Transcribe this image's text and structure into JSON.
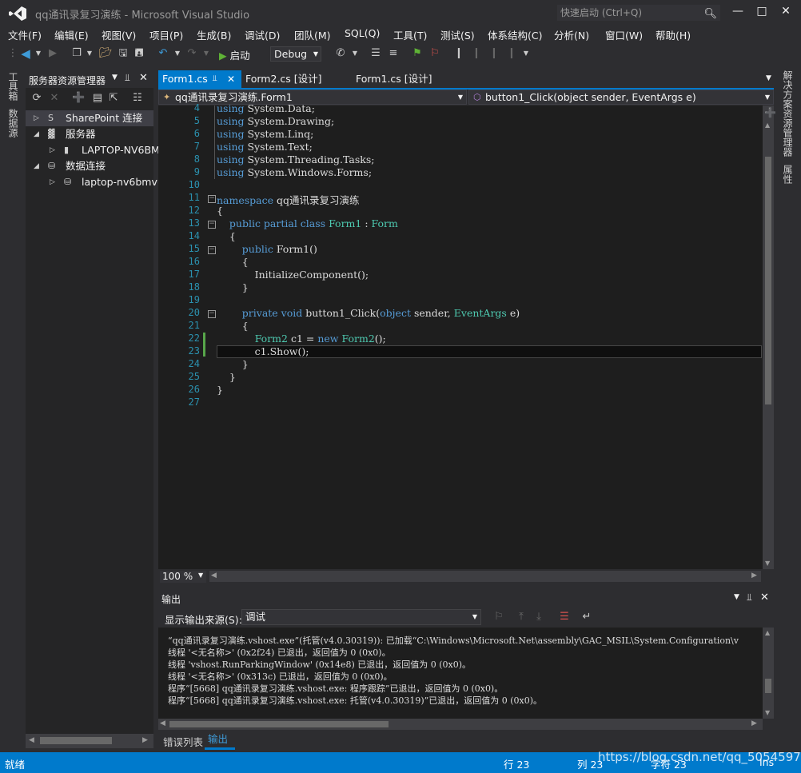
{
  "window": {
    "title": "qq通讯录复习演练 - Microsoft Visual Studio",
    "quick_launch_placeholder": "快速启动 (Ctrl+Q)"
  },
  "menu": [
    "文件(F)",
    "编辑(E)",
    "视图(V)",
    "项目(P)",
    "生成(B)",
    "调试(D)",
    "团队(M)",
    "SQL(Q)",
    "工具(T)",
    "测试(S)",
    "体系结构(C)",
    "分析(N)",
    "窗口(W)",
    "帮助(H)"
  ],
  "toolbar": {
    "start_label": "启动",
    "config": "Debug"
  },
  "left_tabs": [
    "工具箱",
    "数据源"
  ],
  "server_explorer": {
    "title": "服务器资源管理器",
    "tree": [
      {
        "label": "SharePoint 连接",
        "level": 0,
        "expanded": false,
        "selected": true
      },
      {
        "label": "服务器",
        "level": 0,
        "expanded": true
      },
      {
        "label": "LAPTOP-NV6BM",
        "level": 1,
        "expanded": false
      },
      {
        "label": "数据连接",
        "level": 0,
        "expanded": true
      },
      {
        "label": "laptop-nv6bmvu",
        "level": 1,
        "expanded": false
      }
    ]
  },
  "doc_tabs": [
    {
      "label": "Form1.cs",
      "active": true
    },
    {
      "label": "Form2.cs [设计]",
      "active": false
    },
    {
      "label": "Form1.cs [设计]",
      "active": false
    }
  ],
  "nav": {
    "class_sel": "qq通讯录复习演练.Form1",
    "member_sel": "button1_Click(object sender, EventArgs e)"
  },
  "code": {
    "line_numbers": [
      "4",
      "5",
      "6",
      "7",
      "8",
      "9",
      "10",
      "11",
      "12",
      "13",
      "14",
      "15",
      "16",
      "17",
      "18",
      "19",
      "20",
      "21",
      "22",
      "23",
      "24",
      "25",
      "26",
      "27"
    ],
    "lines": [
      [
        {
          "t": "using",
          "c": "kw"
        },
        {
          "t": " System.Data;",
          "c": ""
        }
      ],
      [
        {
          "t": "using",
          "c": "kw"
        },
        {
          "t": " System.Drawing;",
          "c": ""
        }
      ],
      [
        {
          "t": "using",
          "c": "kw"
        },
        {
          "t": " System.Linq;",
          "c": ""
        }
      ],
      [
        {
          "t": "using",
          "c": "kw"
        },
        {
          "t": " System.Text;",
          "c": ""
        }
      ],
      [
        {
          "t": "using",
          "c": "kw"
        },
        {
          "t": " System.Threading.Tasks;",
          "c": ""
        }
      ],
      [
        {
          "t": "using",
          "c": "kw"
        },
        {
          "t": " System.Windows.Forms;",
          "c": ""
        }
      ],
      [],
      [
        {
          "t": "namespace",
          "c": "kw"
        },
        {
          "t": " qq通讯录复习演练",
          "c": ""
        }
      ],
      [
        {
          "t": "{",
          "c": ""
        }
      ],
      [
        {
          "t": "    public partial class",
          "c": "kw"
        },
        {
          "t": " ",
          "c": ""
        },
        {
          "t": "Form1",
          "c": "ty"
        },
        {
          "t": " : ",
          "c": ""
        },
        {
          "t": "Form",
          "c": "ty"
        }
      ],
      [
        {
          "t": "    {",
          "c": ""
        }
      ],
      [
        {
          "t": "        public",
          "c": "kw"
        },
        {
          "t": " Form1()",
          "c": ""
        }
      ],
      [
        {
          "t": "        {",
          "c": ""
        }
      ],
      [
        {
          "t": "            InitializeComponent();",
          "c": ""
        }
      ],
      [
        {
          "t": "        }",
          "c": ""
        }
      ],
      [],
      [
        {
          "t": "        private void",
          "c": "kw"
        },
        {
          "t": " button1_Click(",
          "c": ""
        },
        {
          "t": "object",
          "c": "kw"
        },
        {
          "t": " sender, ",
          "c": ""
        },
        {
          "t": "EventArgs",
          "c": "ty"
        },
        {
          "t": " e)",
          "c": ""
        }
      ],
      [
        {
          "t": "        {",
          "c": ""
        }
      ],
      [
        {
          "t": "            ",
          "c": ""
        },
        {
          "t": "Form2",
          "c": "ty"
        },
        {
          "t": " c1 = ",
          "c": ""
        },
        {
          "t": "new",
          "c": "kw"
        },
        {
          "t": " ",
          "c": ""
        },
        {
          "t": "Form2",
          "c": "ty"
        },
        {
          "t": "();",
          "c": ""
        }
      ],
      [
        {
          "t": "            c1.Show();",
          "c": ""
        }
      ],
      [
        {
          "t": "        }",
          "c": ""
        }
      ],
      [
        {
          "t": "    }",
          "c": ""
        }
      ],
      [
        {
          "t": "}",
          "c": ""
        }
      ],
      []
    ]
  },
  "editor_zoom": "100 %",
  "output": {
    "title": "输出",
    "source_label": "显示输出来源(S):",
    "source_value": "调试",
    "lines": [
      "“qq通讯录复习演练.vshost.exe”(托管(v4.0.30319)): 已加载“C:\\Windows\\Microsoft.Net\\assembly\\GAC_MSIL\\System.Configuration\\v",
      "线程 '<无名称>' (0x2f24) 已退出，返回值为 0 (0x0)。",
      "线程 'vshost.RunParkingWindow' (0x14e8) 已退出，返回值为 0 (0x0)。",
      "线程 '<无名称>' (0x313c) 已退出，返回值为 0 (0x0)。",
      "程序“[5668] qq通讯录复习演练.vshost.exe: 程序跟踪”已退出，返回值为 0 (0x0)。",
      "程序“[5668] qq通讯录复习演练.vshost.exe: 托管(v4.0.30319)”已退出，返回值为 0 (0x0)。"
    ]
  },
  "bottom_tabs": [
    "错误列表",
    "输出"
  ],
  "right_tabs": [
    "解决方案资源管理器",
    "属性"
  ],
  "status": {
    "ready": "就绪",
    "row": "行 23",
    "col": "列 23",
    "char": "字符 23",
    "ins": "Ins",
    "watermark": "https://blog.csdn.net/qq_50545975"
  }
}
